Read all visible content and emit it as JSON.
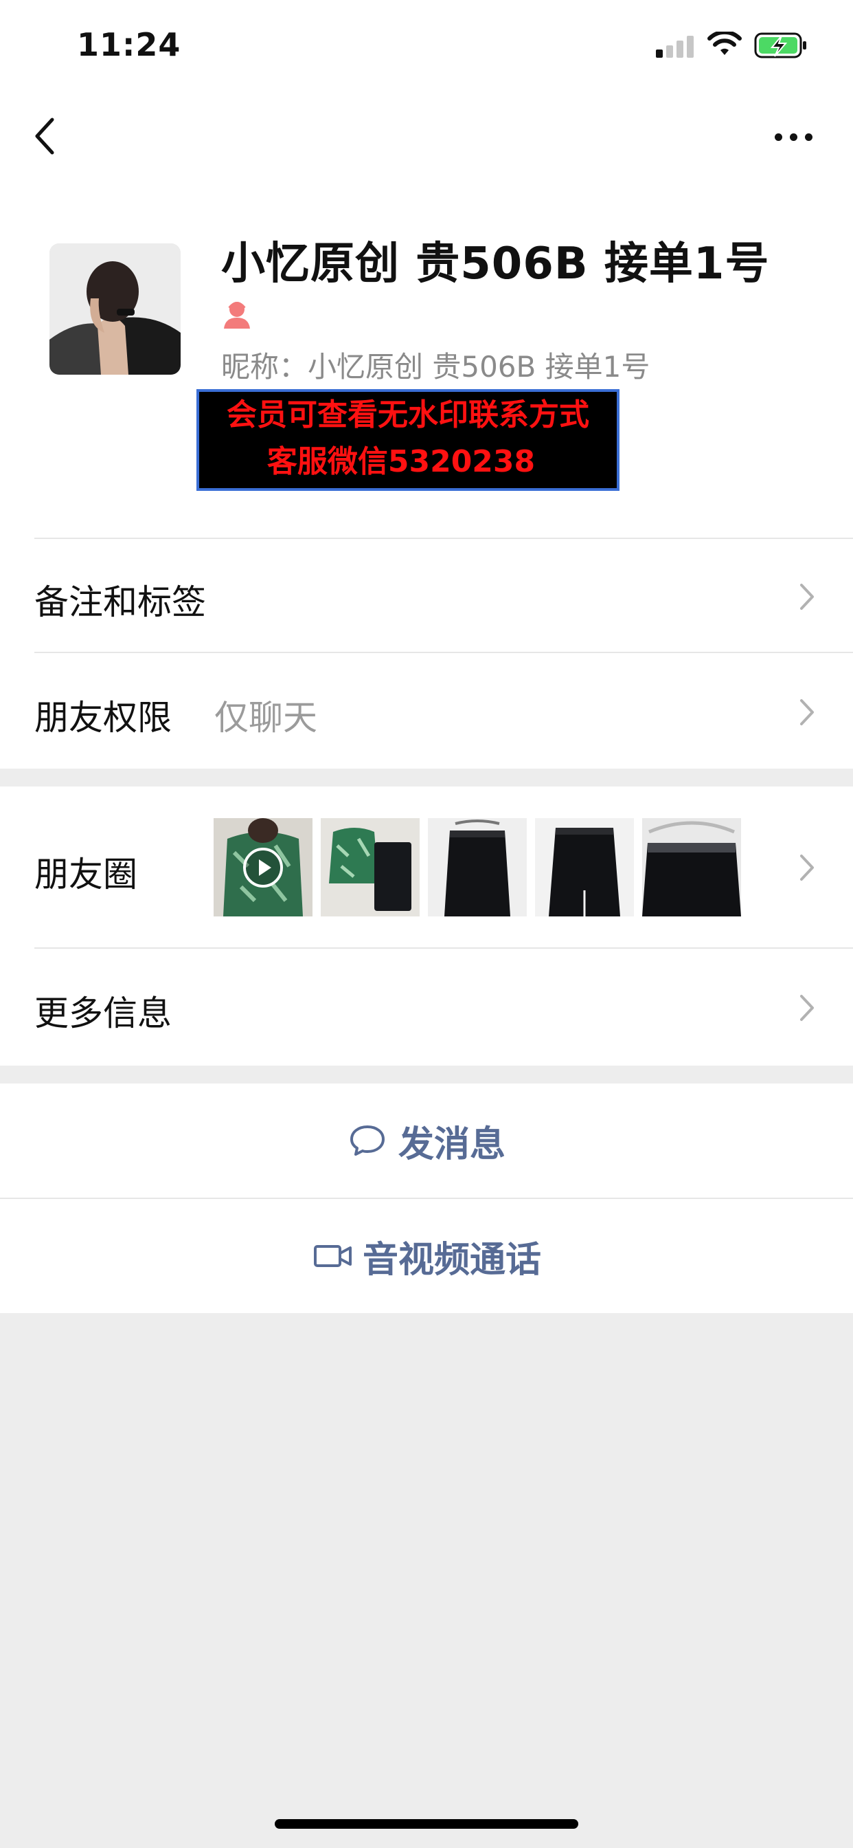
{
  "status_bar": {
    "time": "11:24",
    "icons": [
      "signal-icon",
      "wifi-icon",
      "battery-charging-icon"
    ]
  },
  "nav": {
    "back_icon": "chevron-left-icon",
    "more_icon": "ellipsis-icon"
  },
  "profile": {
    "name": "小忆原创 贵506B 接单1号",
    "gender_icon": "female-user-icon",
    "gender_color": "#f37b7b",
    "nickname": "昵称：小忆原创 贵506B 接单1号",
    "watermark_line1": "会员可查看无水印联系方式",
    "watermark_line2": "客服微信5320238",
    "watermark_text_color": "#ff1111"
  },
  "rows": {
    "remarks_tags": "备注和标签",
    "friend_permissions": "朋友权限",
    "friend_permissions_value": "仅聊天",
    "moments": "朋友圈",
    "more_info": "更多信息"
  },
  "moments_thumbnails": [
    {
      "icon": "green-blouse-video-thumbnail",
      "has_play": true
    },
    {
      "icon": "green-blouse-skirt-thumbnail",
      "has_play": false
    },
    {
      "icon": "black-skirt-thumbnail",
      "has_play": false
    },
    {
      "icon": "black-skirt-back-thumbnail",
      "has_play": false
    },
    {
      "icon": "black-skirt-hanger-thumbnail",
      "has_play": false
    }
  ],
  "actions": {
    "send_message": "发消息",
    "video_call": "音视频通话",
    "link_color": "#576b95"
  }
}
